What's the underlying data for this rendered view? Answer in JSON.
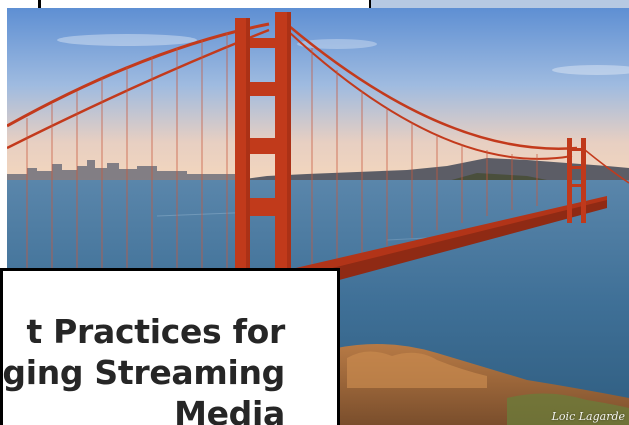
{
  "photo": {
    "subject": "golden-gate-bridge-photo",
    "credit": "Loic Lagarde"
  },
  "title_card": {
    "lines": [
      "t Practices for",
      "oging Streaming",
      "Media"
    ]
  },
  "colors": {
    "sky_top": "#6f9ad6",
    "sky_horizon": "#efd2bd",
    "water": "#3b6f96",
    "bridge": "#c0391b",
    "hill": "#a0663a"
  }
}
